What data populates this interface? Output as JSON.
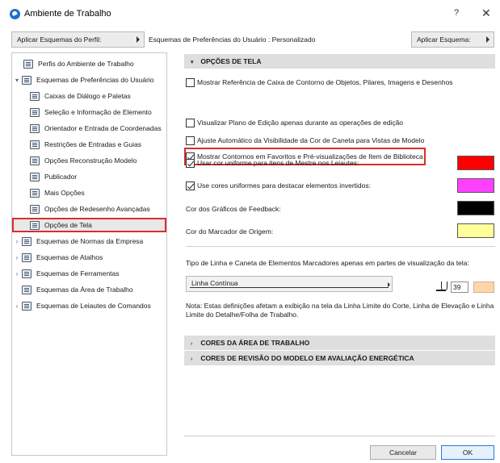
{
  "window": {
    "title": "Ambiente de Trabalho",
    "help": "?",
    "close": "✕"
  },
  "toolbar": {
    "profile_button": "Aplicar Esquemas do Perfil:",
    "scheme_label": "Esquemas de Preferências do Usuário : Personalizado",
    "apply_button": "Aplicar Esquema:"
  },
  "tree": {
    "items": [
      {
        "label": "Perfis do Ambiente de Trabalho",
        "arrow": "",
        "icon": "profiles-icon"
      },
      {
        "label": "Esquemas de Preferências do Usuário",
        "arrow": "▾",
        "icon": "user-preferences-icon"
      },
      {
        "label": "Caixas de Diálogo e Paletas",
        "arrow": "",
        "icon": "dialogs-palettes-icon"
      },
      {
        "label": "Seleção e Informação de Elemento",
        "arrow": "",
        "icon": "selection-info-icon"
      },
      {
        "label": "Orientador e Entrada de Coordenadas",
        "arrow": "",
        "icon": "xyz-coordinates-icon"
      },
      {
        "label": "Restrições de Entradas e Guias",
        "arrow": "",
        "icon": "input-constraints-icon"
      },
      {
        "label": "Opções Reconstrução Modelo",
        "arrow": "",
        "icon": "model-rebuild-icon"
      },
      {
        "label": "Publicador",
        "arrow": "",
        "icon": "publisher-icon"
      },
      {
        "label": "Mais Opções",
        "arrow": "",
        "icon": "more-options-icon"
      },
      {
        "label": "Opções de Redesenho Avançadas",
        "arrow": "",
        "icon": "redraw-options-icon"
      },
      {
        "label": "Opções de Tela",
        "arrow": "",
        "icon": "screen-options-icon"
      },
      {
        "label": "Esquemas de Normas da Empresa",
        "arrow": "›",
        "icon": "company-standards-icon"
      },
      {
        "label": "Esquemas de Atalhos",
        "arrow": "›",
        "icon": "shortcuts-icon"
      },
      {
        "label": "Esquemas de Ferramentas",
        "arrow": "›",
        "icon": "tools-icon"
      },
      {
        "label": "Esquemas da Área de Trabalho",
        "arrow": "",
        "icon": "workspace-icon"
      },
      {
        "label": "Esquemas de Leiautes de Comandos",
        "arrow": "›",
        "icon": "command-layouts-icon"
      }
    ],
    "selected": "Opções de Tela"
  },
  "screen_options": {
    "heading": "OPÇÕES DE TELA",
    "heading_caret": "▾",
    "options": [
      {
        "label": "Mostrar Referência de Caixa de Contorno de Objetos, Pilares, Imagens e Desenhos",
        "checked": false
      },
      {
        "label": "Mostrar Contornos em Favoritos e Pré-visualizações de Item de Biblioteca",
        "checked": true
      },
      {
        "label": "Visualizar Plano de Edição apenas durante as operações de edição",
        "checked": false
      },
      {
        "label": "Ajuste Automático da Visibilidade da Cor de Caneta para Vistas de Modelo",
        "checked": false
      },
      {
        "label": "Usar cor uniforme para itens de Mestre nos Leiautes:",
        "checked": true,
        "swatch": "#ff0000"
      },
      {
        "label": "Use cores uniformes para destacar elementos invertidos:",
        "checked": true,
        "swatch": "#ff40ff"
      }
    ],
    "feedback_color_label": "Cor dos Gráficos de Feedback:",
    "feedback_color": "#000000",
    "origin_color_label": "Cor do Marcador de Origem:",
    "origin_color": "#ffff99",
    "marker_line_label": "Tipo de Linha e Caneta de Elementos Marcadores apenas em partes de visualização da tela:",
    "line_type": "Linha Contínua",
    "pen_number": "39",
    "pen_color": "#ffd6a8",
    "note": "Nota: Estas definições afetam a exibição na tela da Linha Limite do Corte, Linha de Elevação e Linha Limite do Detalhe/Folha de Trabalho."
  },
  "collapsed_sections": [
    {
      "label": "CORES DA ÁREA DE TRABALHO",
      "caret": "›"
    },
    {
      "label": "CORES DE REVISÃO DO MODELO EM AVALIAÇÃO ENERGÉTICA",
      "caret": "›"
    }
  ],
  "footer": {
    "cancel": "Cancelar",
    "ok": "OK"
  },
  "colors": {
    "highlight_border": "#d92d2d",
    "section_background": "#dedede",
    "ok_border": "#2a7ad8"
  }
}
